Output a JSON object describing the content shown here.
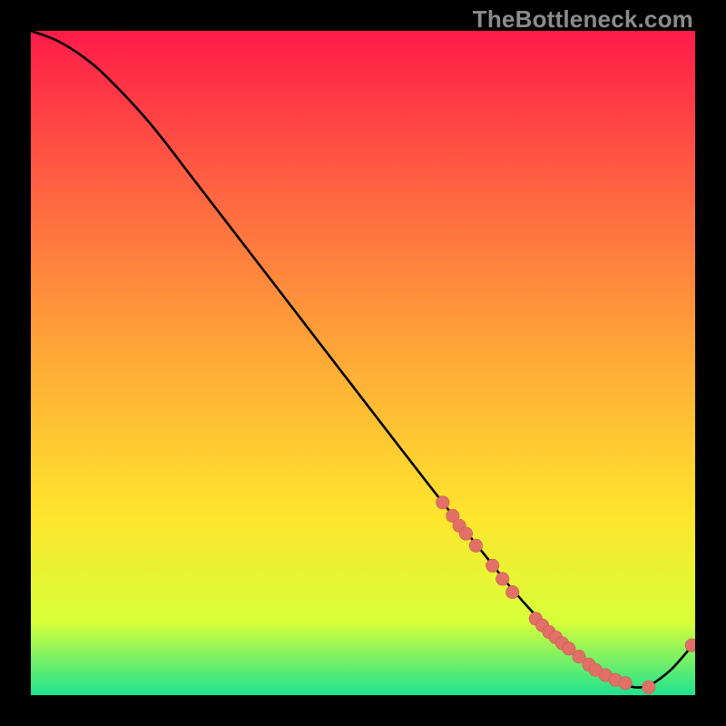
{
  "watermark": "TheBottleneck.com",
  "colors": {
    "gradient_top": "#fe1b48",
    "gradient_mid1": "#ff5e42",
    "gradient_mid2": "#ffa638",
    "gradient_mid3": "#ffe52d",
    "gradient_green_top": "#d7ff3a",
    "gradient_green": "#1ee28f",
    "curve": "#000000",
    "marker_fill": "#e27067",
    "marker_stroke": "#c85a55"
  },
  "chart_data": {
    "type": "line",
    "title": "",
    "xlabel": "",
    "ylabel": "",
    "xlim": [
      0,
      100
    ],
    "ylim": [
      0,
      100
    ],
    "curve": {
      "x": [
        0,
        4,
        8,
        12,
        18,
        25,
        35,
        45,
        55,
        62,
        68,
        72,
        76,
        80,
        84,
        88,
        92,
        96,
        100
      ],
      "y": [
        100,
        98.5,
        96,
        92.5,
        86,
        77,
        64,
        51,
        38,
        29,
        21.5,
        16.5,
        12,
        8,
        4.5,
        2.2,
        1.2,
        3.5,
        8
      ]
    },
    "markers": {
      "x": [
        62,
        63.5,
        64.5,
        65.5,
        67,
        69.5,
        71,
        72.5,
        76,
        77,
        78,
        79,
        80,
        81,
        82.5,
        84,
        85,
        86.5,
        88,
        89.5,
        93,
        99.5
      ],
      "y": [
        29,
        27,
        25.5,
        24.3,
        22.5,
        19.5,
        17.5,
        15.5,
        11.5,
        10.5,
        9.5,
        8.7,
        7.8,
        7,
        5.8,
        4.6,
        3.8,
        3,
        2.3,
        1.8,
        1.2,
        7.5
      ]
    }
  }
}
